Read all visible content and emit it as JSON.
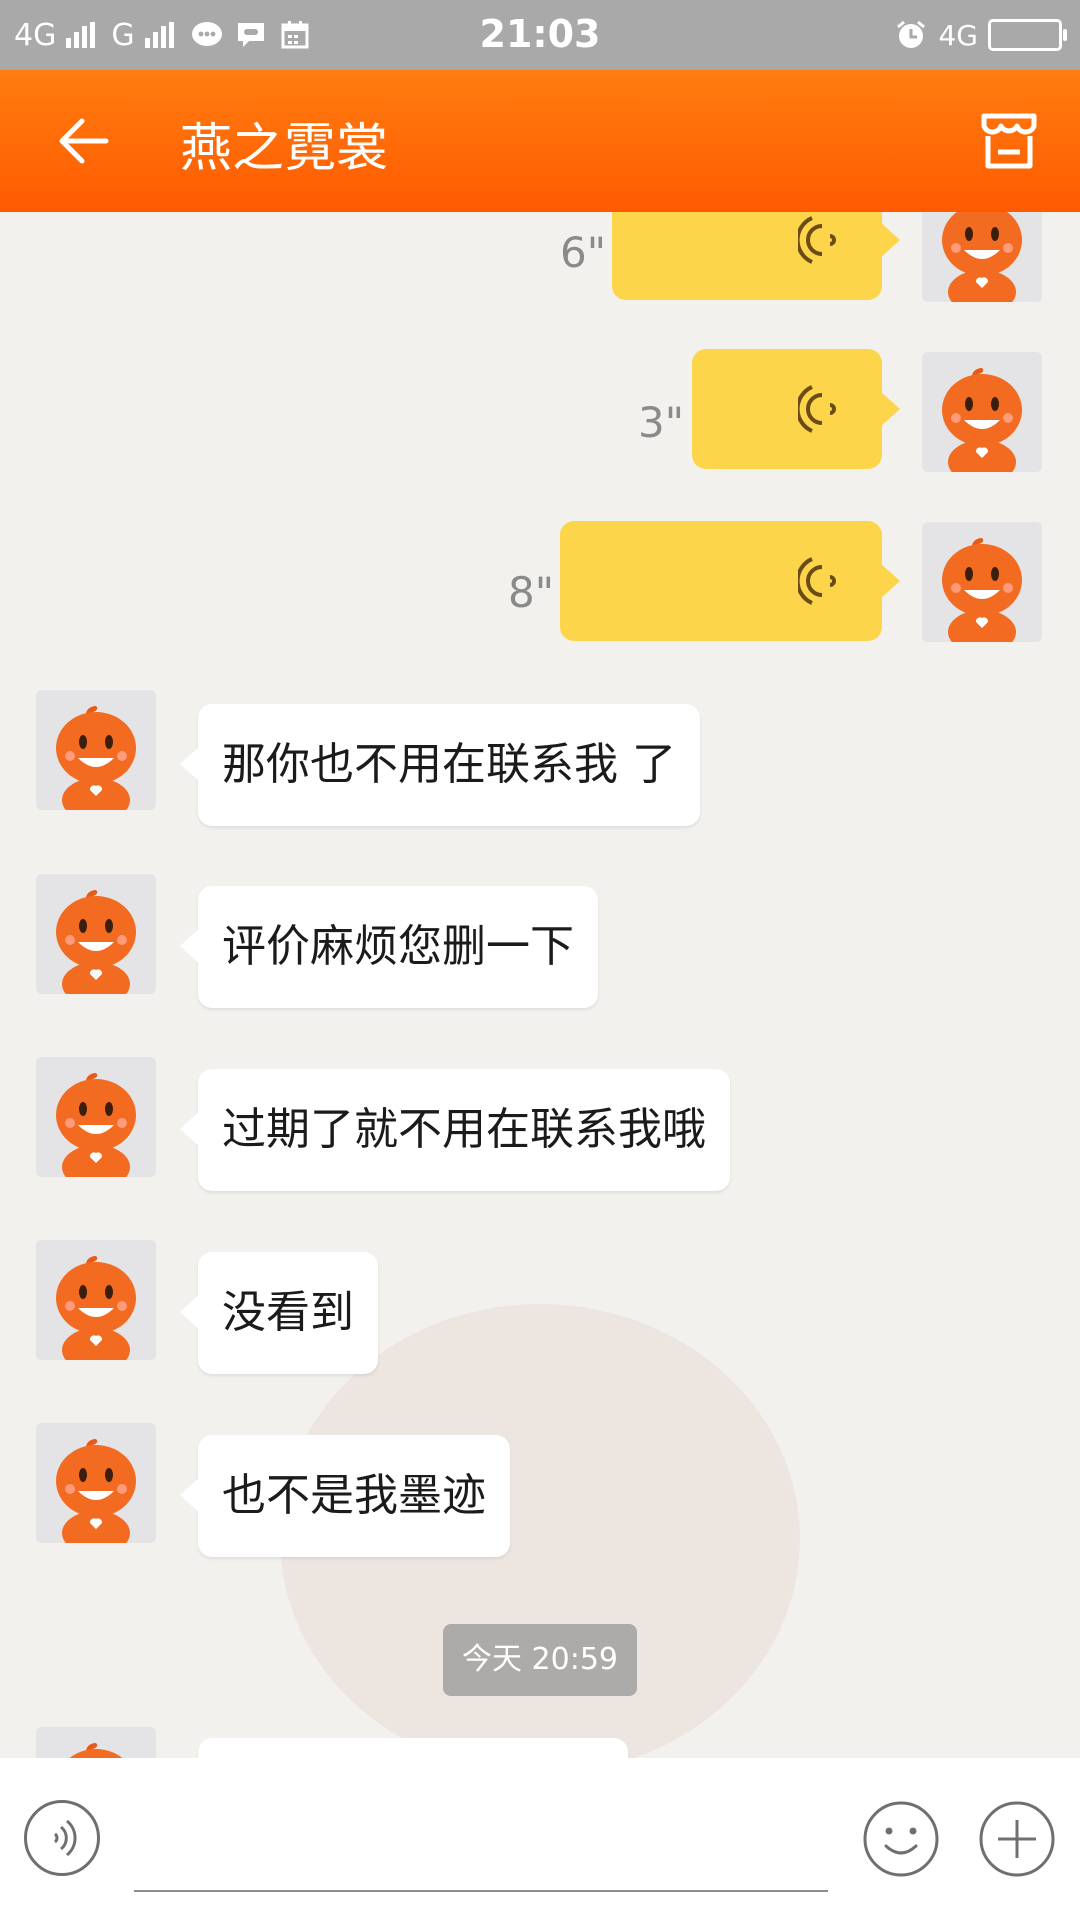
{
  "status_bar": {
    "network_left": "4G",
    "carrier_2": "G",
    "time": "21:03",
    "network_right": "4G"
  },
  "app_bar": {
    "title": "燕之霓裳",
    "back_icon": "arrow-left-icon",
    "store_icon": "store-icon"
  },
  "messages": [
    {
      "type": "voice",
      "from": "self",
      "duration": "6\""
    },
    {
      "type": "voice",
      "from": "self",
      "duration": "3\""
    },
    {
      "type": "voice",
      "from": "self",
      "duration": "8\""
    },
    {
      "type": "text",
      "from": "other",
      "text": "那你也不用在联系我 了"
    },
    {
      "type": "text",
      "from": "other",
      "text": "评价麻烦您删一下"
    },
    {
      "type": "text",
      "from": "other",
      "text": "过期了就不用在联系我哦"
    },
    {
      "type": "text",
      "from": "other",
      "text": "没看到"
    },
    {
      "type": "text",
      "from": "other",
      "text": "也不是我墨迹"
    }
  ],
  "time_divider": "今天 20:59",
  "input_bar": {
    "voice_icon": "voice-input-icon",
    "emoji_icon": "emoji-icon",
    "plus_icon": "plus-icon"
  },
  "colors": {
    "app_bar": "#ff6a00",
    "voice_bubble": "#fdd54b",
    "background": "#f2f1ee"
  }
}
